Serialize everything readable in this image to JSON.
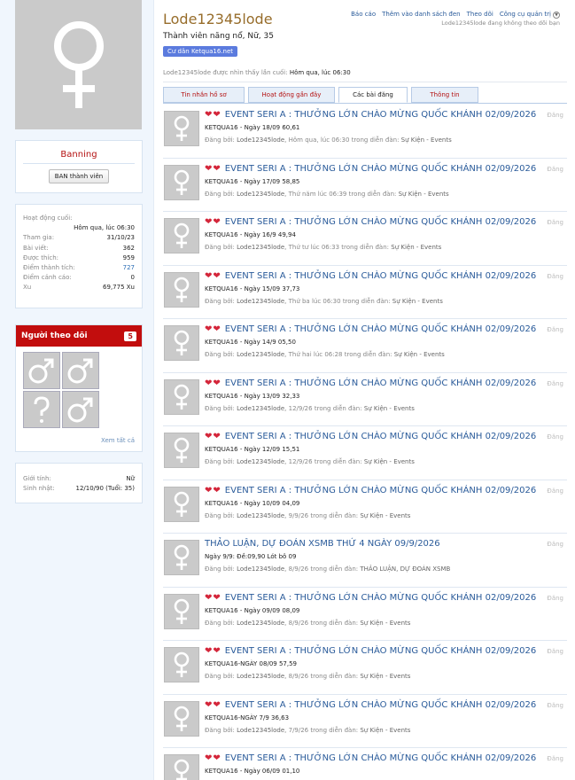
{
  "profile": {
    "username": "Lode12345lode",
    "user_title": "Thành viên năng nổ, Nữ, 35",
    "tag": "Cư dân Ketqua16.net",
    "last_seen_label": "Lode12345lode được nhìn thấy lần cuối:",
    "last_seen_value": "Hôm qua, lúc 06:30",
    "avatar_icon": "female-symbol-icon"
  },
  "top_links": [
    "Báo cáo",
    "Thêm vào danh sách đen",
    "Theo dõi",
    "Công cụ quản trị"
  ],
  "top_note": "Lode12345lode đang không theo dõi bạn",
  "ban": {
    "title": "Banning",
    "button": "BAN thành viên"
  },
  "stats": {
    "activity_label": "Hoạt động cuối:",
    "activity_value": "Hôm qua, lúc 06:30",
    "rows": [
      {
        "label": "Tham gia:",
        "value": "31/10/23"
      },
      {
        "label": "Bài viết:",
        "value": "362"
      },
      {
        "label": "Được thích:",
        "value": "959"
      },
      {
        "label": "Điểm thành tích:",
        "value": "727"
      },
      {
        "label": "Điểm cảnh cáo:",
        "value": "0"
      },
      {
        "label": "Xu",
        "value": "69,775 Xu"
      }
    ]
  },
  "followers": {
    "title": "Người theo dõi",
    "count": "5",
    "see_all": "Xem tất cả",
    "icons": [
      "male-symbol-icon",
      "male-symbol-icon",
      "unknown-gender-icon",
      "male-symbol-icon"
    ]
  },
  "info": {
    "rows": [
      {
        "label": "Giới tính:",
        "value": "Nữ"
      },
      {
        "label": "Sinh nhật:",
        "value": "12/10/90 (Tuổi: 35)"
      }
    ]
  },
  "tabs": [
    "Tin nhắn hồ sơ",
    "Hoạt động gần đây",
    "Các bài đăng",
    "Thông tin"
  ],
  "active_tab": 2,
  "posts": [
    {
      "hearts": true,
      "title": "EVENT SERI A : THƯỞNG LỚN CHÀO MỪNG QUỐC KHÁNH 02/09/2026",
      "line": "KETQUA16 - Ngày 18/09 60,61",
      "author": "Lode12345lode",
      "when": "Hôm qua, lúc 06:30",
      "forum": "Sự Kiện - Events",
      "type": "Đăng"
    },
    {
      "hearts": true,
      "title": "EVENT SERI A : THƯỞNG LỚN CHÀO MỪNG QUỐC KHÁNH 02/09/2026",
      "line": "KETQUA16 - Ngày 17/09 58,85",
      "author": "Lode12345lode",
      "when": "Thứ năm lúc 06:39",
      "forum": "Sự Kiện - Events",
      "type": "Đăng"
    },
    {
      "hearts": true,
      "title": "EVENT SERI A : THƯỞNG LỚN CHÀO MỪNG QUỐC KHÁNH 02/09/2026",
      "line": "KETQUA16 - Ngày 16/9 49,94",
      "author": "Lode12345lode",
      "when": "Thứ tư lúc 06:33",
      "forum": "Sự Kiện - Events",
      "type": "Đăng"
    },
    {
      "hearts": true,
      "title": "EVENT SERI A : THƯỞNG LỚN CHÀO MỪNG QUỐC KHÁNH 02/09/2026",
      "line": "KETQUA16 - Ngày 15/09 37,73",
      "author": "Lode12345lode",
      "when": "Thứ ba lúc 06:30",
      "forum": "Sự Kiện - Events",
      "type": "Đăng"
    },
    {
      "hearts": true,
      "title": "EVENT SERI A : THƯỞNG LỚN CHÀO MỪNG QUỐC KHÁNH 02/09/2026",
      "line": "KETQUA16 - Ngày 14/9 05,50",
      "author": "Lode12345lode",
      "when": "Thứ hai lúc 06:28",
      "forum": "Sự Kiện - Events",
      "type": "Đăng"
    },
    {
      "hearts": true,
      "title": "EVENT SERI A : THƯỞNG LỚN CHÀO MỪNG QUỐC KHÁNH 02/09/2026",
      "line": "KETQUA16 - Ngày 13/09 32,33",
      "author": "Lode12345lode",
      "when": "12/9/26",
      "forum": "Sự Kiện - Events",
      "type": "Đăng"
    },
    {
      "hearts": true,
      "title": "EVENT SERI A : THƯỞNG LỚN CHÀO MỪNG QUỐC KHÁNH 02/09/2026",
      "line": "KETQUA16 - Ngày 12/09 15,51",
      "author": "Lode12345lode",
      "when": "12/9/26",
      "forum": "Sự Kiện - Events",
      "type": "Đăng"
    },
    {
      "hearts": true,
      "title": "EVENT SERI A : THƯỞNG LỚN CHÀO MỪNG QUỐC KHÁNH 02/09/2026",
      "line": "KETQUA16 - Ngày 10/09 04,09",
      "author": "Lode12345lode",
      "when": "9/9/26",
      "forum": "Sự Kiện - Events",
      "type": "Đăng"
    },
    {
      "hearts": false,
      "title": "THẢO LUẬN, DỰ ĐOÁN XSMB THỨ 4 NGÀY 09/9/2026",
      "line": "Ngày 9/9: Đề:09,90 Lót bô 09",
      "author": "Lode12345lode",
      "when": "8/9/26",
      "forum": "THẢO LUẬN, DỰ ĐOÁN XSMB",
      "type": "Đăng"
    },
    {
      "hearts": true,
      "title": "EVENT SERI A : THƯỞNG LỚN CHÀO MỪNG QUỐC KHÁNH 02/09/2026",
      "line": "KETQUA16 - Ngày 09/09 08,09",
      "author": "Lode12345lode",
      "when": "8/9/26",
      "forum": "Sự Kiện - Events",
      "type": "Đăng"
    },
    {
      "hearts": true,
      "title": "EVENT SERI A : THƯỞNG LỚN CHÀO MỪNG QUỐC KHÁNH 02/09/2026",
      "line": "KETQUA16-NGÀY 08/09 57,59",
      "author": "Lode12345lode",
      "when": "8/9/26",
      "forum": "Sự Kiện - Events",
      "type": "Đăng"
    },
    {
      "hearts": true,
      "title": "EVENT SERI A : THƯỞNG LỚN CHÀO MỪNG QUỐC KHÁNH 02/09/2026",
      "line": "KETQUA16-NGÀY 7/9 36,63",
      "author": "Lode12345lode",
      "when": "7/9/26",
      "forum": "Sự Kiện - Events",
      "type": "Đăng"
    },
    {
      "hearts": true,
      "title": "EVENT SERI A : THƯỞNG LỚN CHÀO MỪNG QUỐC KHÁNH 02/09/2026",
      "line": "KETQUA16 - Ngày 06/09 01,10",
      "author": "",
      "when": "",
      "forum": "",
      "type": "Đăng"
    }
  ],
  "meta_words": {
    "posted_by": "Đăng bởi:",
    "in_forum": "trong diễn đàn:"
  },
  "colors": {
    "accent": "#2a5b9a",
    "danger": "#c20d0d",
    "username": "#976d2b",
    "tag": "#5b7bde"
  }
}
